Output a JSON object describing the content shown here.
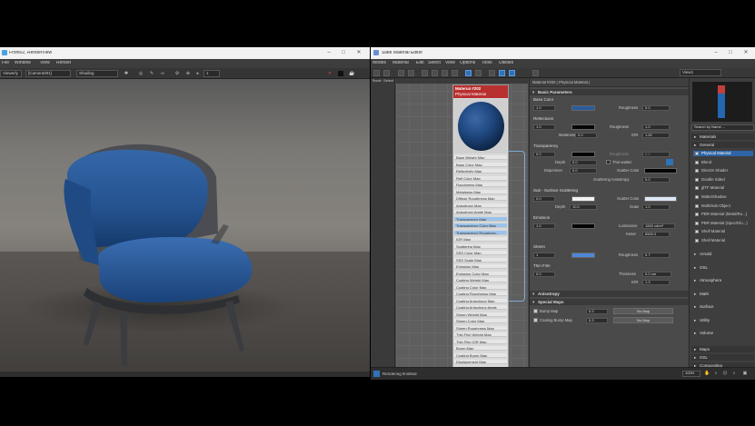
{
  "render_window": {
    "title": "Front02, RenderView",
    "menu": [
      "File",
      "Window",
      "View",
      "Render"
    ],
    "toolbar": {
      "dropdown1": "Viewerly",
      "dropdown2": "[Camera001]",
      "dropdown3": "Shading",
      "zoom": "1"
    }
  },
  "slate": {
    "title": "Slate Material Editor",
    "menu": [
      "Modes",
      "Material",
      "Edit",
      "Select",
      "View",
      "Options",
      "Tools",
      "Utilities"
    ],
    "view_tab": "View1",
    "browser_tabs": [
      "Brush",
      "Select"
    ],
    "node": {
      "title_line1": "Material #202",
      "title_line2": "Physical Material",
      "slots": [
        "Base Weight Map",
        "Base Color Map",
        "Reflectivity Map",
        "Refl Color Map",
        "Roughness Map",
        "Metalness Map",
        "Diffuse Roughness Map",
        "Anisotropy Map",
        "Anisotropy Angle Map",
        "Transparency Map",
        "Transparency Color Map",
        "Transparency Roughnes...",
        "IOR Map",
        "Scattering Map",
        "SSS Color Map",
        "SSS Scale Map",
        "Emission Map",
        "Emission Color Map",
        "Coating Weight Map",
        "Coating Color Map",
        "Coating Roughness Map",
        "Coating Anisotropy Map",
        "Coating Anisotropy Angle",
        "Sheen Weight Map",
        "Sheen Color Map",
        "Sheen Roughness Map",
        "Thin Film Weight Map",
        "Thin Film IOR Map",
        "Bump Map",
        "Coating Bump Map",
        "Displacement Map"
      ]
    },
    "params": {
      "header": "Material #202 ( Physical Material )",
      "sections": {
        "basic": "Basic Parameters",
        "anisotropy": "Anisotropy",
        "special": "Special Maps"
      },
      "base_color": {
        "group": "Base Color",
        "weight": "1.0",
        "roughness_label": "Roughness",
        "roughness": "0.0"
      },
      "reflections": {
        "group": "Reflections",
        "weight": "1.0",
        "roughness_label": "Roughness",
        "roughness": "1.0",
        "metalness_label": "Metalness",
        "metalness": "0.0",
        "ior_label": "IOR",
        "ior": "1.52"
      },
      "transparency": {
        "group": "Transparency",
        "weight": "0.0",
        "roughness_label": "Roughness",
        "roughness": "0.0",
        "depth_label": "Depth",
        "depth": "0.0",
        "thin_walled": "Thin-walled",
        "dispersion_label": "Dispersion",
        "dispersion": "0.0",
        "scatter_label": "Scatter Color",
        "anisotropy_label": "Scattering Anisotropy",
        "anisotropy": "0.0"
      },
      "sss": {
        "group": "Sub - Surface Scattering",
        "weight": "0.0",
        "scatter_label": "Scatter Color",
        "depth_label": "Depth",
        "depth": "10.0",
        "scale_label": "Scale",
        "scale": "1.0"
      },
      "emission": {
        "group": "Emission",
        "weight": "1.0",
        "luminance_label": "Luminance",
        "luminance": "1500 cd/m²",
        "kelvin_label": "Kelvin",
        "kelvin": "6500.0"
      },
      "sheen": {
        "group": "Sheen",
        "weight": "1",
        "roughness_label": "Roughness",
        "roughness": "0.7"
      },
      "thinfilm": {
        "group": "Thin Film",
        "weight": "0.0",
        "thickness_label": "Thickness",
        "thickness": "0.0 nm",
        "ior_label": "IOR",
        "ior": "1.3"
      },
      "special": {
        "bump_label": "Bump Map",
        "bump": "0.3",
        "bump_btn": "No Map",
        "coat_label": "Coating Bump Map",
        "coat": "0.3",
        "coat_btn": "No Map"
      }
    },
    "browser": {
      "tab": "View1",
      "search": "Search by Name ...",
      "sections": [
        "Materials",
        "General"
      ],
      "materials": [
        "Physical Material",
        "Blend",
        "DirectX Shader",
        "Double Sided",
        "glTF Material",
        "Matte/Shadow",
        "Multi/Sub-Object",
        "PBR Material (Metal/Ro...)",
        "PBR Material (Spec/Glo...)",
        "Shell Material",
        "Shell Material"
      ],
      "lower_groups": [
        "Arnold",
        "OSL",
        "Atmosphere",
        "Math",
        "Surface",
        "Utility",
        "Volume"
      ],
      "maps_section": "Maps",
      "maps": [
        "OSL",
        "Compositing"
      ],
      "zoom": "100%"
    },
    "status": "Rendering finished"
  },
  "colors": {
    "chair_blue": "#2a5c9e",
    "accent_blue": "#2f72b8",
    "node_header_red": "#b8302f"
  }
}
